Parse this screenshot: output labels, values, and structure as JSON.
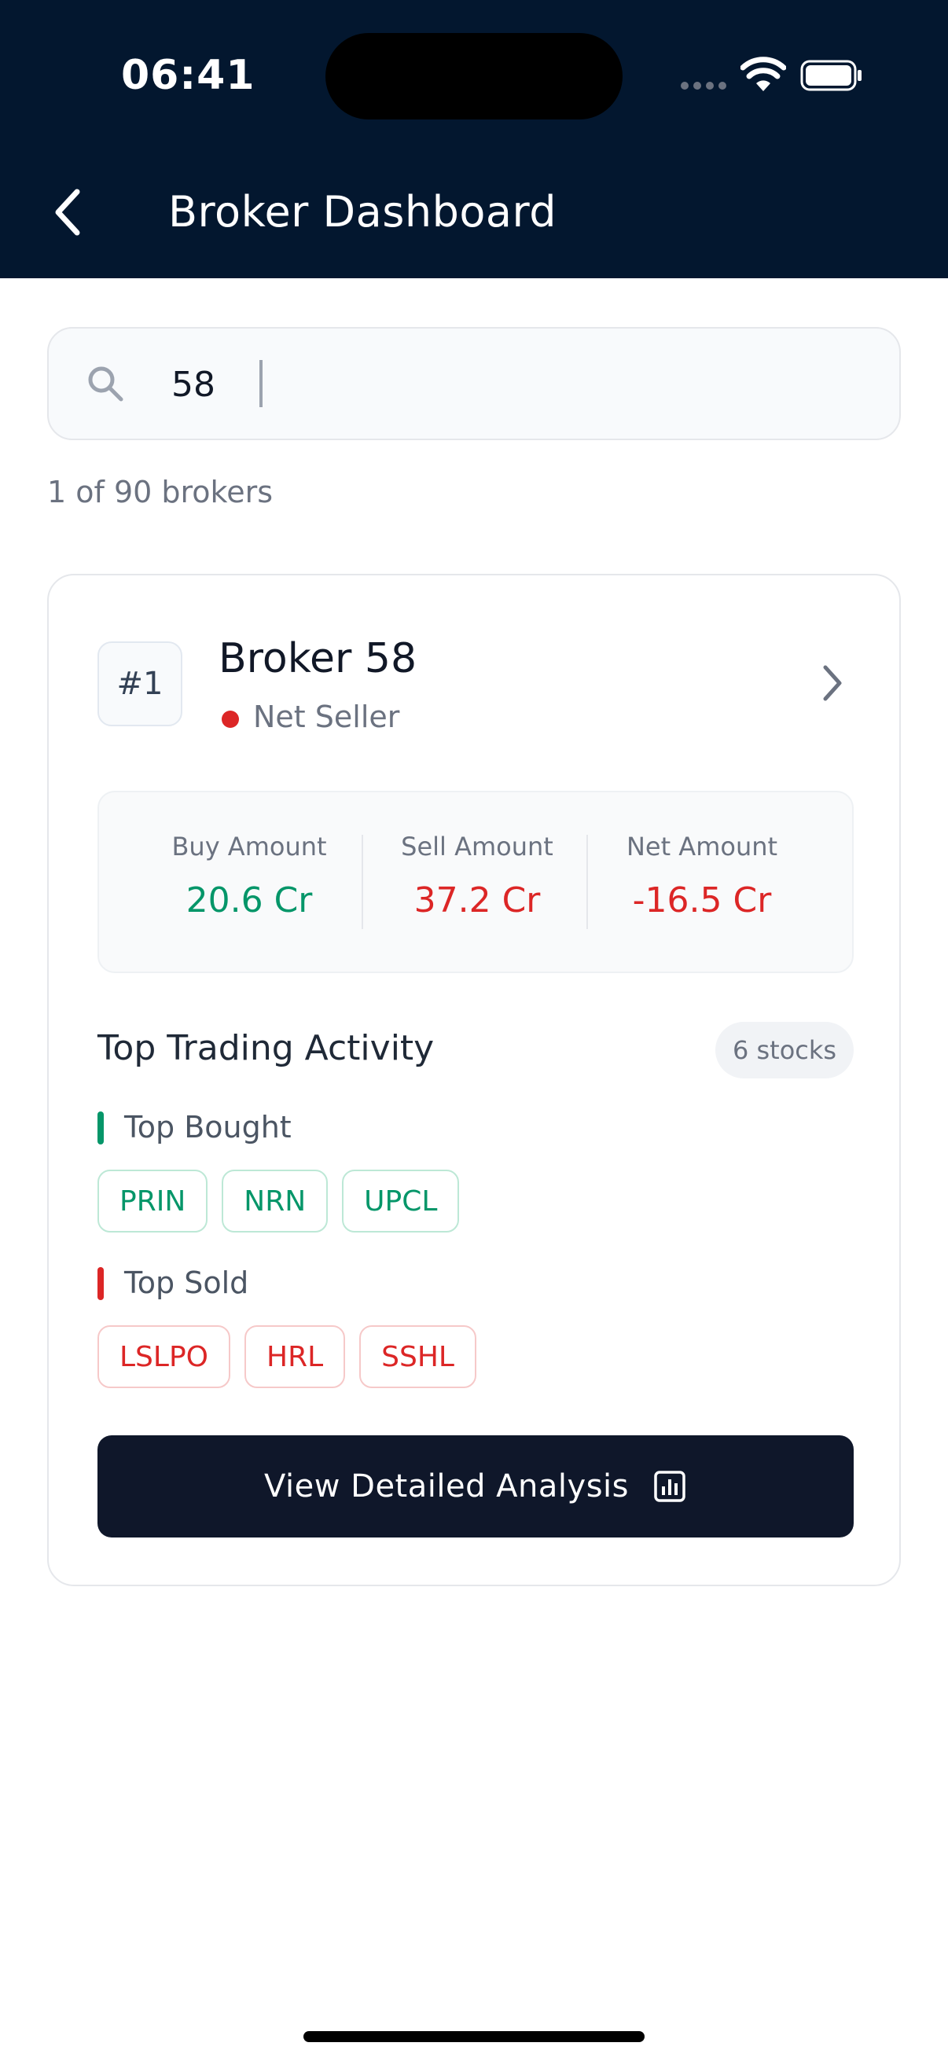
{
  "status_bar": {
    "time": "06:41"
  },
  "header": {
    "title": "Broker Dashboard",
    "back_icon": "chevron-left-icon"
  },
  "search": {
    "value": "58",
    "placeholder": ""
  },
  "results": {
    "count_text": "1 of 90 brokers"
  },
  "broker": {
    "rank": "#1",
    "name": "Broker 58",
    "status": "Net Seller",
    "status_color": "#dc2626",
    "stats": [
      {
        "label": "Buy Amount",
        "value": "20.6 Cr",
        "color": "#059669"
      },
      {
        "label": "Sell Amount",
        "value": "37.2 Cr",
        "color": "#dc2626"
      },
      {
        "label": "Net Amount",
        "value": "-16.5 Cr",
        "color": "#dc2626"
      }
    ],
    "activity": {
      "title": "Top Trading Activity",
      "stock_count": "6 stocks",
      "top_bought_label": "Top Bought",
      "top_bought": [
        "PRIN",
        "NRN",
        "UPCL"
      ],
      "top_sold_label": "Top Sold",
      "top_sold": [
        "LSLPO",
        "HRL",
        "SSHL"
      ]
    },
    "action_label": "View Detailed Analysis",
    "action_icon": "bar-chart-icon"
  },
  "colors": {
    "header_bg": "#03172f",
    "buy": "#059669",
    "sell": "#dc2626",
    "button_bg": "#0f172a"
  }
}
